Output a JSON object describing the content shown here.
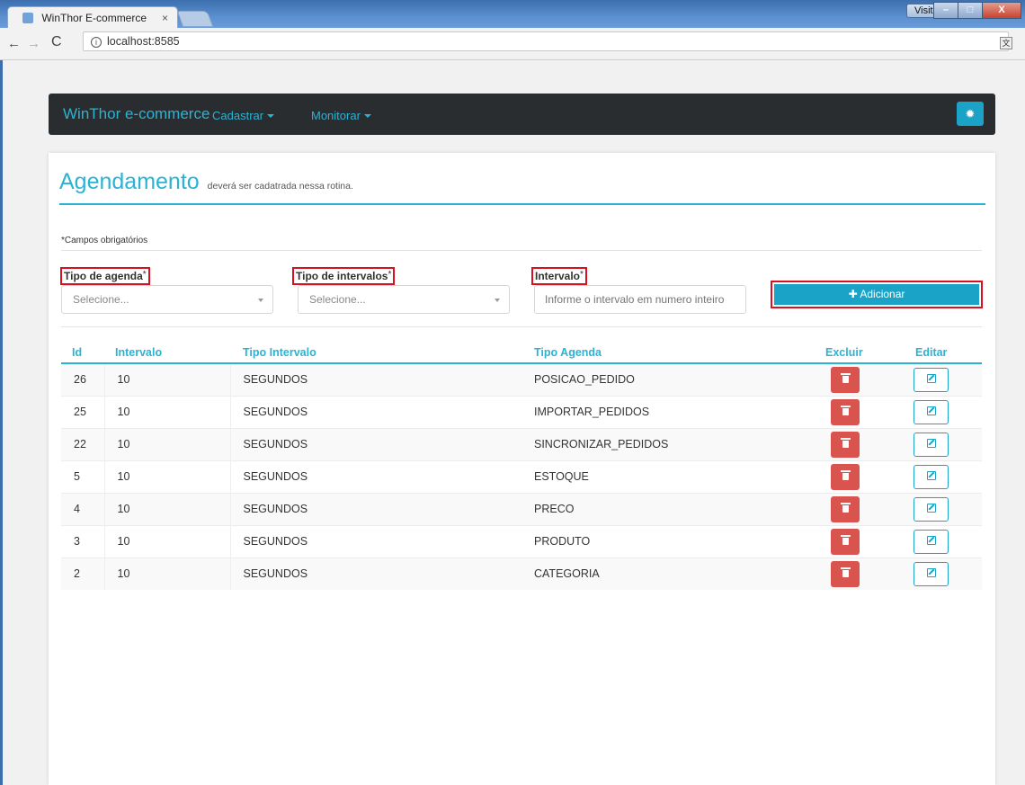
{
  "browser": {
    "tab_title": "WinThor E-commerce",
    "tab_close": "×",
    "address": "localhost:8585",
    "user_badge": "Visitante"
  },
  "navbar": {
    "brand": "WinThor e-commerce",
    "menus": [
      "Cadastrar",
      "Monitorar"
    ]
  },
  "page": {
    "title": "Agendamento",
    "subtitle": "deverá ser cadatrada nessa rotina.",
    "required_note": "*Campos obrigatórios"
  },
  "form": {
    "tipo_agenda": {
      "label": "Tipo de agenda",
      "star": "*",
      "placeholder": "Selecione..."
    },
    "tipo_intervalos": {
      "label": "Tipo de intervalos",
      "star": "*",
      "placeholder": "Selecione..."
    },
    "intervalo": {
      "label": "Intervalo",
      "star": "*",
      "placeholder": "Informe o intervalo em numero inteiro"
    },
    "add_button": "Adicionar",
    "add_icon": "plus-icon"
  },
  "table": {
    "columns": [
      "Id",
      "Intervalo",
      "Tipo Intervalo",
      "Tipo Agenda",
      "Excluir",
      "Editar"
    ],
    "rows": [
      {
        "id": "26",
        "intervalo": "10",
        "tipo_intervalo": "SEGUNDOS",
        "tipo_agenda": "POSICAO_PEDIDO"
      },
      {
        "id": "25",
        "intervalo": "10",
        "tipo_intervalo": "SEGUNDOS",
        "tipo_agenda": "IMPORTAR_PEDIDOS"
      },
      {
        "id": "22",
        "intervalo": "10",
        "tipo_intervalo": "SEGUNDOS",
        "tipo_agenda": "SINCRONIZAR_PEDIDOS"
      },
      {
        "id": "5",
        "intervalo": "10",
        "tipo_intervalo": "SEGUNDOS",
        "tipo_agenda": "ESTOQUE"
      },
      {
        "id": "4",
        "intervalo": "10",
        "tipo_intervalo": "SEGUNDOS",
        "tipo_agenda": "PRECO"
      },
      {
        "id": "3",
        "intervalo": "10",
        "tipo_intervalo": "SEGUNDOS",
        "tipo_agenda": "PRODUTO"
      },
      {
        "id": "2",
        "intervalo": "10",
        "tipo_intervalo": "SEGUNDOS",
        "tipo_agenda": "CATEGORIA"
      }
    ]
  },
  "colors": {
    "accent": "#2bb3d3",
    "primary_button": "#1aa3c7",
    "danger": "#d9534f",
    "navbar_bg": "#2a2d30",
    "highlight_box": "#d9101f"
  },
  "icons": {
    "settings": "gear-icon",
    "delete": "trash-icon",
    "edit": "edit-icon"
  }
}
